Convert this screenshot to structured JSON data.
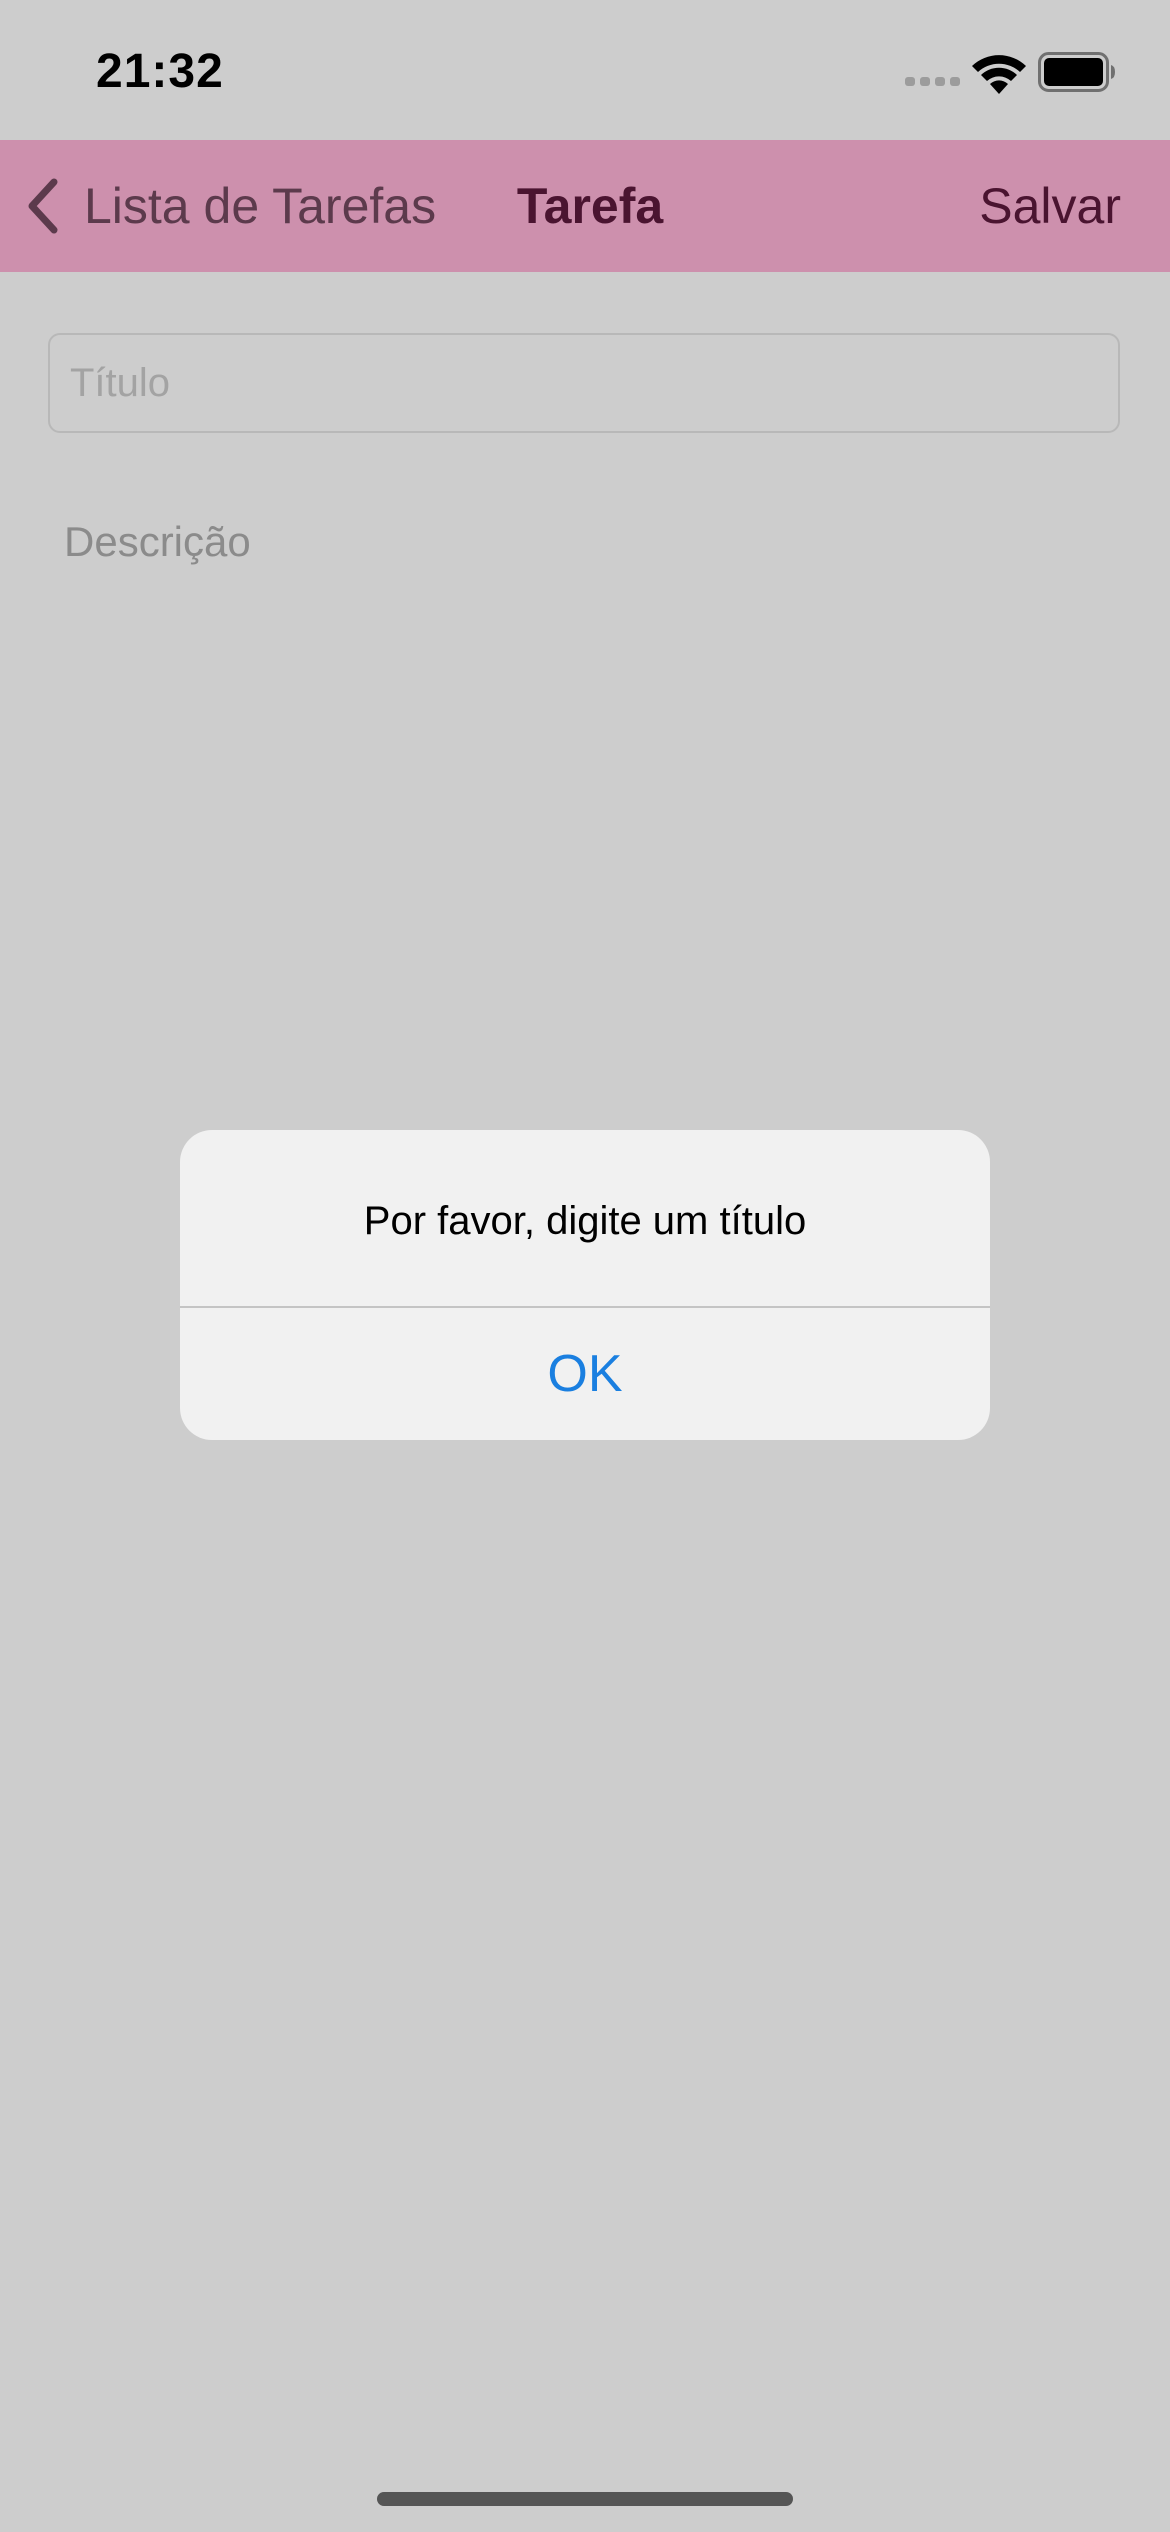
{
  "status_bar": {
    "time": "21:32",
    "icons": [
      "signal-icon",
      "wifi-icon",
      "battery-icon"
    ]
  },
  "nav_bar": {
    "back_label": "Lista de Tarefas",
    "back_icon": "chevron-left-icon",
    "title": "Tarefa",
    "save_label": "Salvar",
    "background_color": "#cd90ad"
  },
  "form": {
    "title_placeholder": "Título",
    "title_value": "",
    "description_placeholder": "Descrição",
    "description_value": ""
  },
  "alert": {
    "message": "Por favor, digite um título",
    "ok_label": "OK",
    "ok_color": "#1a7fe0"
  }
}
